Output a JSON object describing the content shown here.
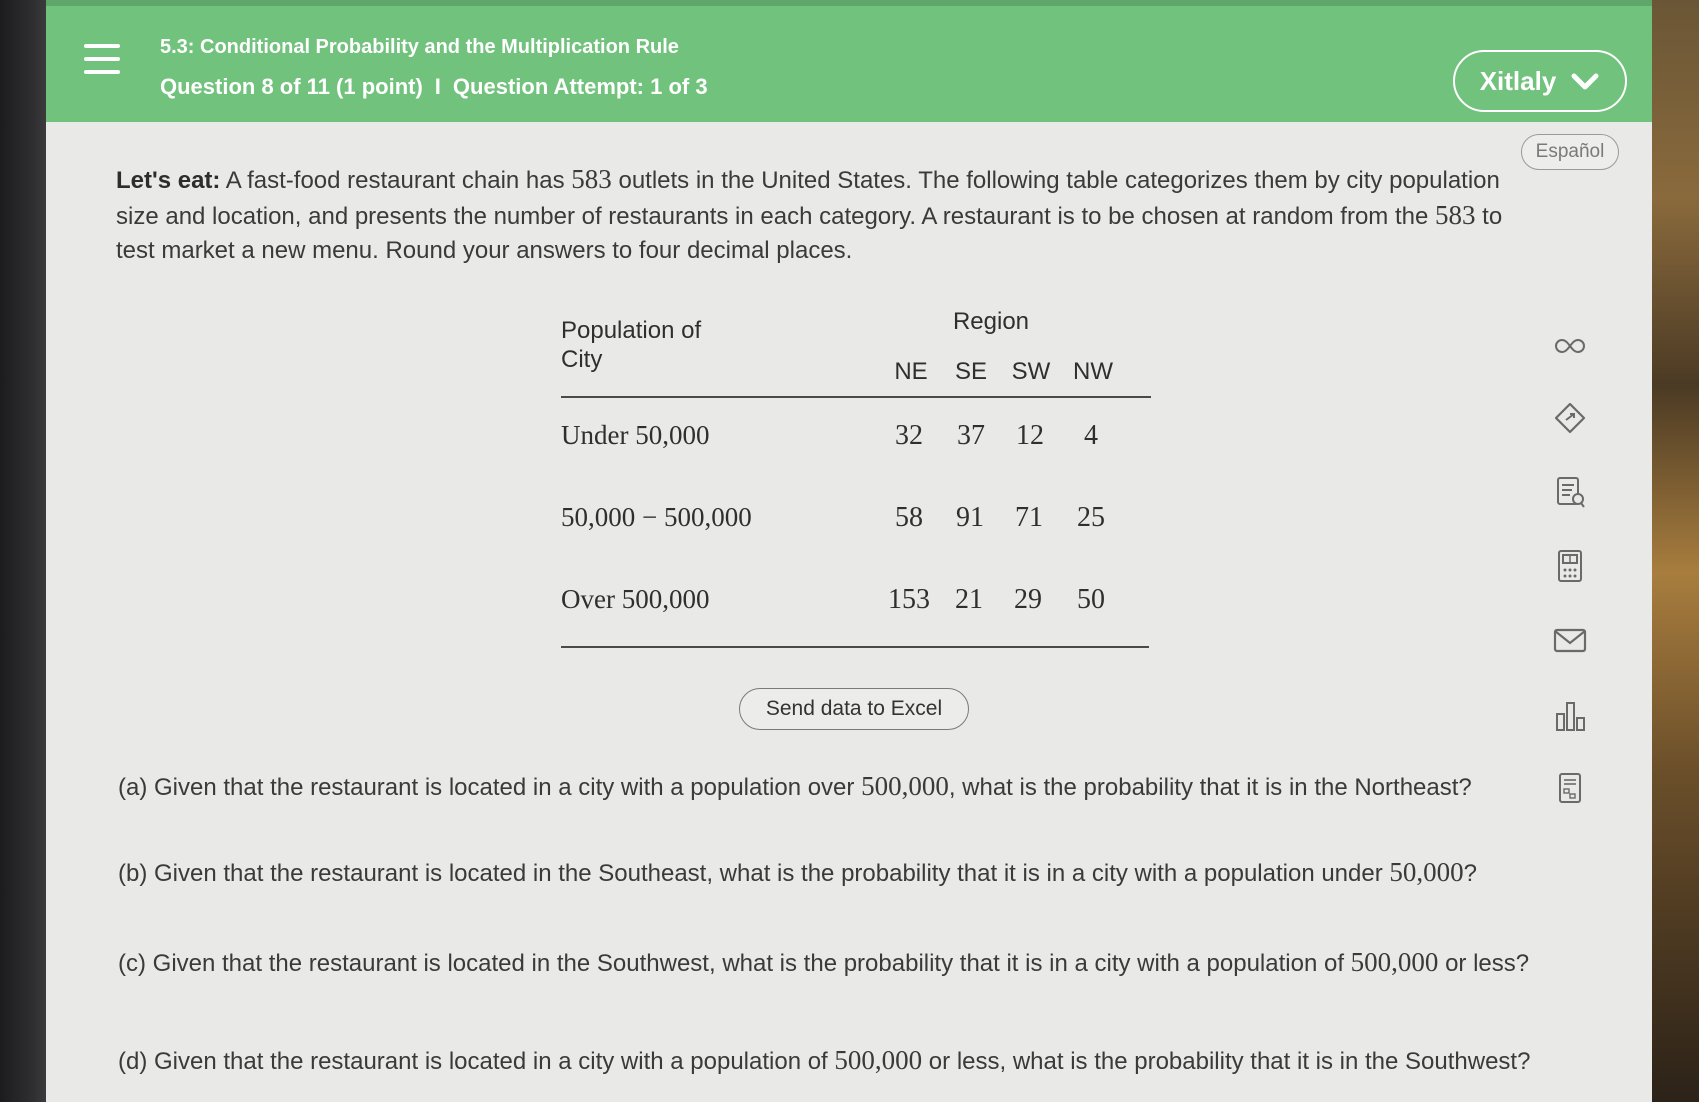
{
  "header": {
    "section_title": "5.3: Conditional Probability and the Multiplication Rule",
    "question_info": "Question 8 of 11 (1 point)",
    "separator": "I",
    "attempt_info": "Question Attempt: 1 of 3",
    "user_name": "Xitlaly"
  },
  "language_button": "Español",
  "intro": {
    "lead": "Let's eat:",
    "part1": " A fast-food restaurant chain has ",
    "num1": "583",
    "part2": " outlets in the United States. The following table categorizes them by city population size and location, and presents the number of restaurants in each category. A restaurant is to be chosen at random from the ",
    "num2": "583",
    "part3": " to test market a new menu. Round your answers to four decimal places."
  },
  "table": {
    "row_header": "Population of City",
    "group_header": "Region",
    "columns": [
      "NE",
      "SE",
      "SW",
      "NW"
    ],
    "rows": [
      {
        "label": "Under 50,000",
        "values": [
          "32",
          "37",
          "12",
          "4"
        ]
      },
      {
        "label": "50,000 − 500,000",
        "values": [
          "58",
          "91",
          "71",
          "25"
        ]
      },
      {
        "label": "Over 500,000",
        "values": [
          "153",
          "21",
          "29",
          "50"
        ]
      }
    ]
  },
  "excel_button": "Send data to Excel",
  "questions": {
    "a": {
      "before": "(a) Given that the restaurant is located in a city with a population over ",
      "num": "500,000",
      "after": ", what is the probability that it is in the Northeast?"
    },
    "b": {
      "before": "(b) Given that the restaurant is located in the Southeast, what is the probability that it is in a city with a population under ",
      "num": "50,000",
      "after": "?"
    },
    "c": {
      "before": "(c) Given that the restaurant is located in the Southwest, what is the probability that it is in a city with a population of ",
      "num": "500,000",
      "after": " or less?"
    },
    "d": {
      "before": "(d) Given that the restaurant is located in a city with a population of ",
      "num": "500,000",
      "after": " or less, what is the probability that it is in the Southwest?"
    }
  },
  "side_tools": [
    "infinity-icon",
    "tag-icon",
    "notes-icon",
    "calculator-icon",
    "mail-icon",
    "bar-chart-icon",
    "data-sheet-icon"
  ],
  "colors": {
    "header_green": "#70c27c",
    "page_bg": "#e9e9e7",
    "text": "#3a3a3a"
  }
}
